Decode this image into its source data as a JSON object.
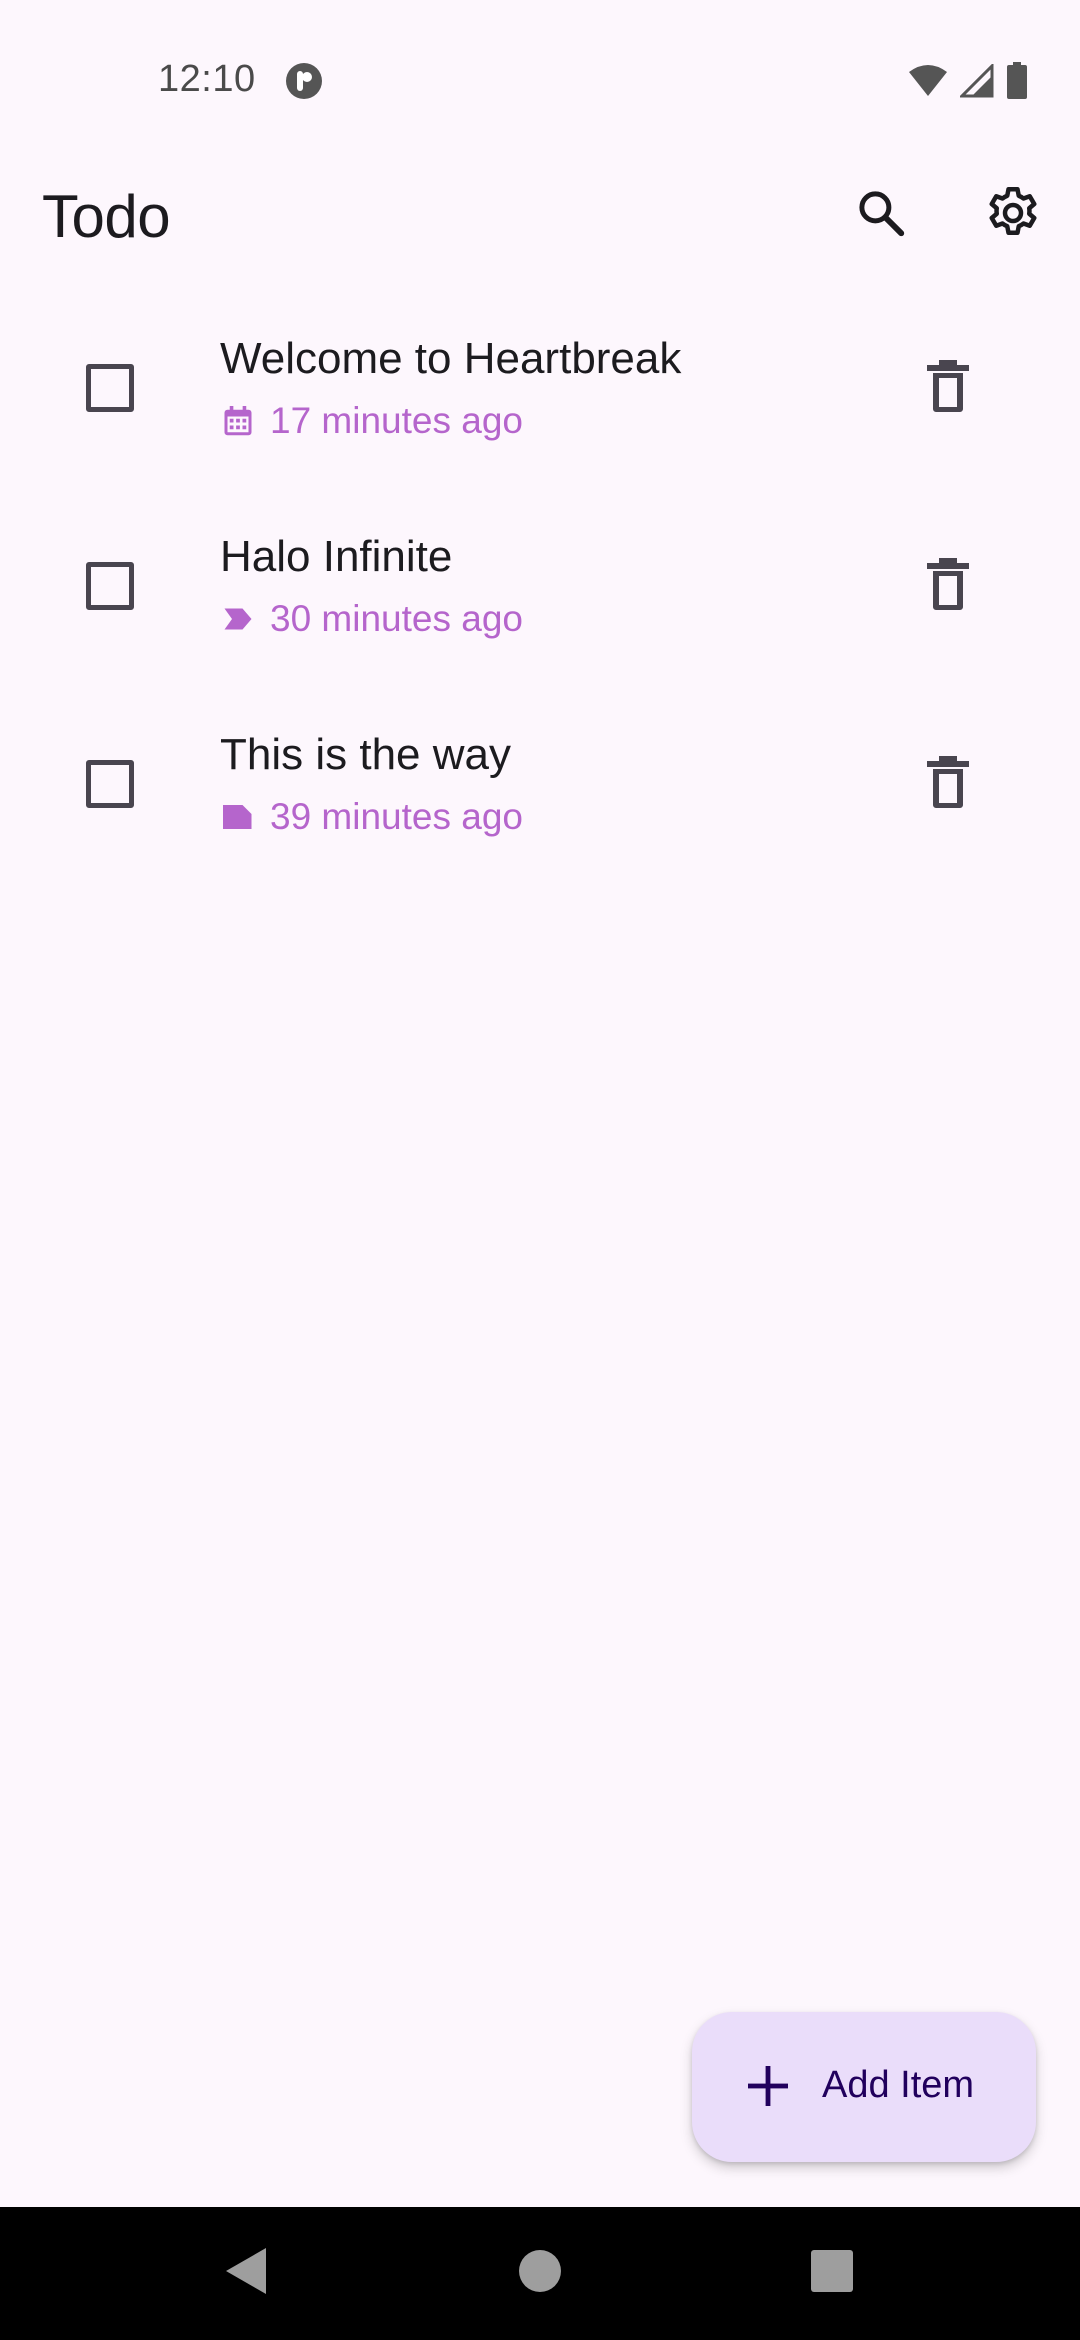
{
  "status_bar": {
    "time": "12:10"
  },
  "app_bar": {
    "title": "Todo",
    "actions": [
      {
        "icon": "search-icon"
      },
      {
        "icon": "gear-icon"
      }
    ]
  },
  "todos": [
    {
      "title": "Welcome to Heartbreak",
      "time": "17 minutes ago",
      "category_icon": "calendar-icon",
      "checked": false
    },
    {
      "title": "Halo Infinite",
      "time": "30 minutes ago",
      "category_icon": "label-icon",
      "checked": false
    },
    {
      "title": "This is the way",
      "time": "39 minutes ago",
      "category_icon": "folder-icon",
      "checked": false
    }
  ],
  "fab": {
    "label": "Add Item",
    "icon": "plus-icon"
  },
  "colors": {
    "background": "#FDF7FD",
    "accent": "#B565CC",
    "fab_background": "#EADDFA",
    "fab_text": "#21005D",
    "icon_dark": "#49454F"
  }
}
